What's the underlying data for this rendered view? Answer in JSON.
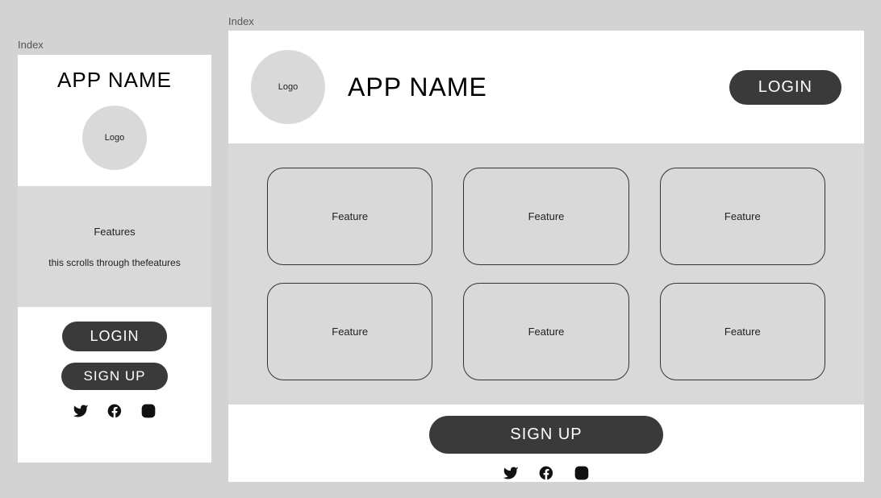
{
  "mobile": {
    "frame_label": "Index",
    "app_title": "APP NAME",
    "logo_label": "Logo",
    "features_title": "Features",
    "features_desc": "this scrolls through thefeatures",
    "login_label": "LOGIN",
    "signup_label": "SIGN UP"
  },
  "desktop": {
    "frame_label": "Index",
    "app_title": "APP NAME",
    "logo_label": "Logo",
    "login_label": "LOGIN",
    "signup_label": "SIGN UP",
    "features": [
      {
        "label": "Feature"
      },
      {
        "label": "Feature"
      },
      {
        "label": "Feature"
      },
      {
        "label": "Feature"
      },
      {
        "label": "Feature"
      },
      {
        "label": "Feature"
      }
    ]
  },
  "social": {
    "twitter": "twitter-icon",
    "facebook": "facebook-icon",
    "instagram": "instagram-icon"
  }
}
